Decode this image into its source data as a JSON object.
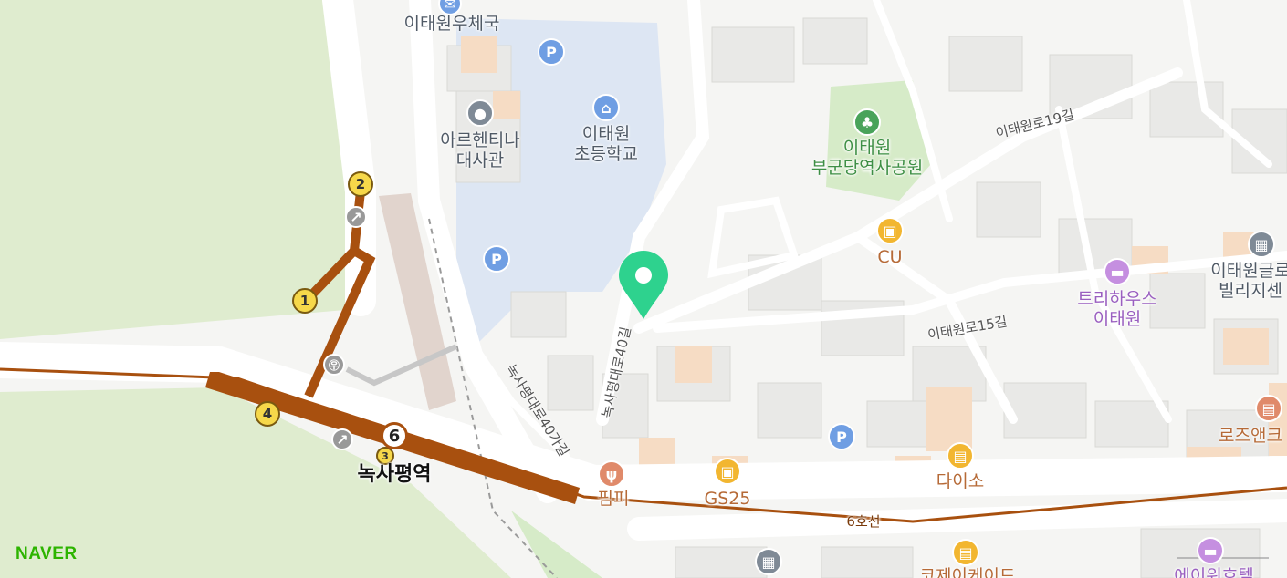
{
  "brand": "NAVER",
  "line": {
    "number": "6",
    "label": "6호선",
    "color": "#a8500f"
  },
  "station": {
    "name": "녹사평역",
    "exits": [
      "1",
      "2",
      "3",
      "4"
    ]
  },
  "labels": {
    "post_office": "이태원우체국",
    "embassy_1": "아르헨티나",
    "embassy_2": "대사관",
    "school_1": "이태원",
    "school_2": "초등학교",
    "park_1": "이태원",
    "park_2": "부군당역사공원",
    "cu": "CU",
    "road_19": "이태원로19길",
    "road_15": "이태원로15길",
    "road_40": "녹사평대로40길",
    "road_40ga": "녹사평대로40가길",
    "trihouse_1": "트리하우스",
    "trihouse_2": "이태원",
    "global_1": "이태원글로",
    "global_2": "빌리지센",
    "rose": "로즈앤크",
    "pimpi": "핌피",
    "gs25": "GS25",
    "daiso": "다이소",
    "bottom_hotel": "에이워호텔",
    "bottom_arcade": "코제이케이드"
  },
  "icons": {
    "parking": "P",
    "underpass": "㉾"
  },
  "colors": {
    "park": "#dfeccf",
    "pin": "#2ed28e",
    "poi_blue": "#6f9ee3",
    "poi_yellow": "#f2b630"
  }
}
